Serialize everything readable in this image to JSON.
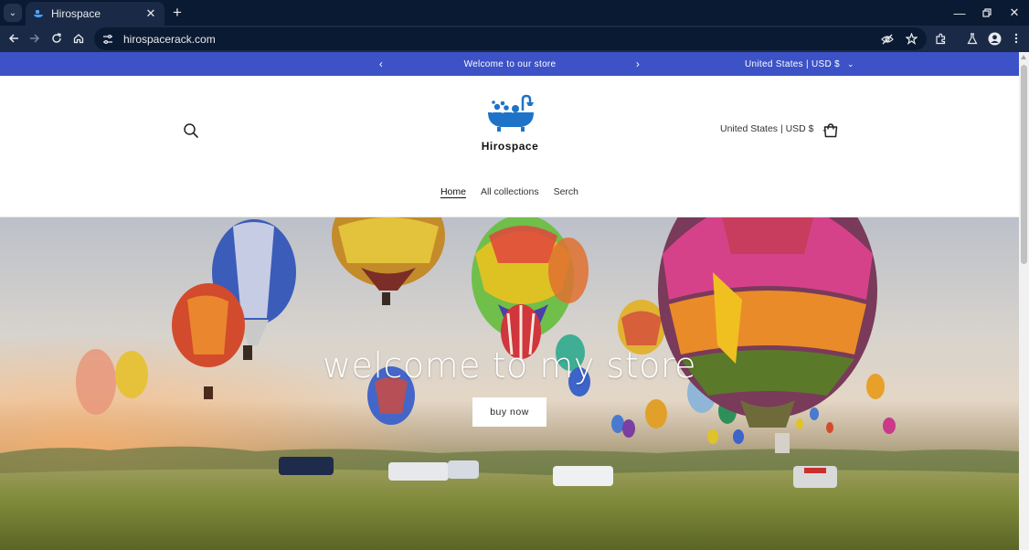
{
  "browser": {
    "tab_title": "Hirospace",
    "url": "hirospacerack.com"
  },
  "announcement": {
    "message": "Welcome to our store",
    "country_currency": "United States | USD $"
  },
  "header": {
    "brand_name": "Hirospace",
    "country_currency": "United States | USD $",
    "menu": [
      {
        "label": "Home",
        "active": true
      },
      {
        "label": "All collections",
        "active": false
      },
      {
        "label": "Serch",
        "active": false
      }
    ]
  },
  "hero": {
    "headline": "welcome to my store",
    "button_label": "buy now"
  },
  "colors": {
    "announcement_bar": "#3c52c6",
    "logo_blue": "#1e73c8",
    "browser_chrome": "#0b1a33"
  },
  "icons": [
    "tab-list-icon",
    "favicon-icon",
    "close-icon",
    "plus-icon",
    "minimize-icon",
    "restore-icon",
    "back-icon",
    "forward-icon",
    "reload-icon",
    "home-icon",
    "site-info-icon",
    "eye-off-icon",
    "star-icon",
    "extensions-icon",
    "labs-icon",
    "profile-icon",
    "menu-icon",
    "search-icon",
    "cart-icon",
    "chevron-left-icon",
    "chevron-right-icon",
    "chevron-down-icon"
  ]
}
